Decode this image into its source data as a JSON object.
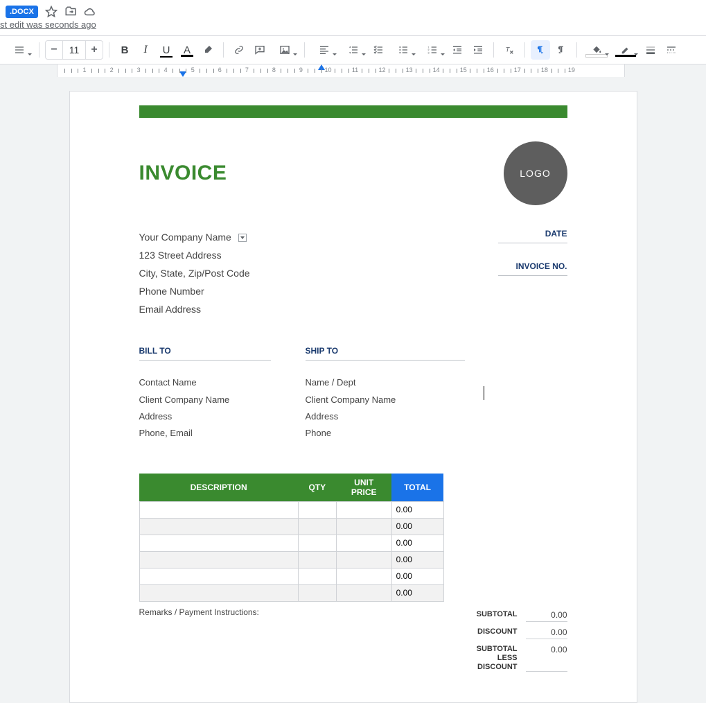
{
  "header": {
    "docx_chip": ".DOCX",
    "edit_status": "st edit was seconds ago"
  },
  "toolbar": {
    "font_size": "11"
  },
  "ruler": {
    "numbers": [
      1,
      2,
      3,
      4,
      5,
      6,
      7,
      8,
      9,
      10,
      11,
      12,
      13,
      14,
      15,
      16,
      17,
      18,
      19
    ]
  },
  "invoice": {
    "title": "INVOICE",
    "logo_text": "LOGO",
    "company": {
      "name": "Your Company Name",
      "street": "123 Street Address",
      "city": "City, State, Zip/Post Code",
      "phone": "Phone Number",
      "email": "Email Address"
    },
    "date_label": "DATE",
    "invoice_no_label": "INVOICE NO.",
    "bill_to_label": "BILL TO",
    "ship_to_label": "SHIP TO",
    "bill_to": {
      "contact": "Contact Name",
      "company": "Client Company Name",
      "address": "Address",
      "phone_email": "Phone, Email"
    },
    "ship_to": {
      "name_dept": "Name / Dept",
      "company": "Client Company Name",
      "address": "Address",
      "phone": "Phone"
    },
    "columns": {
      "description": "DESCRIPTION",
      "qty": "QTY",
      "unit_price": "UNIT PRICE",
      "total": "TOTAL"
    },
    "rows": [
      {
        "total": "0.00"
      },
      {
        "total": "0.00"
      },
      {
        "total": "0.00"
      },
      {
        "total": "0.00"
      },
      {
        "total": "0.00"
      },
      {
        "total": "0.00"
      }
    ],
    "remarks_label": "Remarks / Payment Instructions:",
    "summary": {
      "subtotal_label": "SUBTOTAL",
      "subtotal": "0.00",
      "discount_label": "DISCOUNT",
      "discount": "0.00",
      "subtotal_less_label1": "SUBTOTAL",
      "subtotal_less_label2": "LESS",
      "subtotal_less_label3": "DISCOUNT",
      "subtotal_less": "0.00"
    }
  }
}
